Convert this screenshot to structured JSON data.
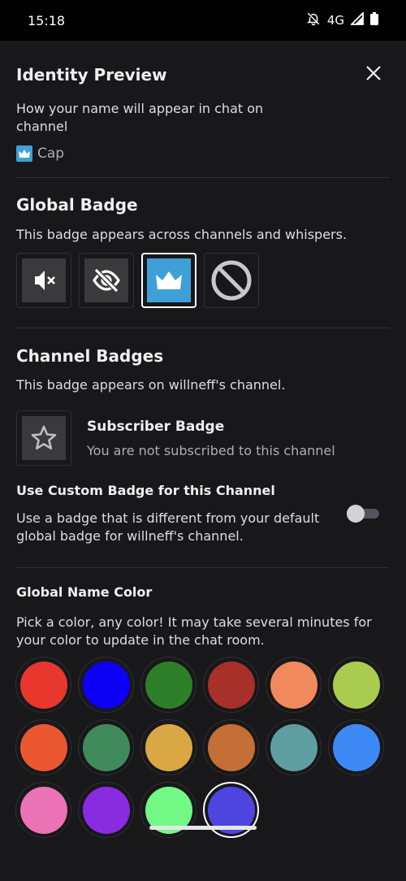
{
  "status_bar": {
    "time": "15:18",
    "network": "4G"
  },
  "header": {
    "title": "Identity Preview"
  },
  "preview": {
    "description": "How your name will appear in chat on channel",
    "name": "Cap"
  },
  "global_badge": {
    "title": "Global Badge",
    "description": "This badge appears across channels and whispers.",
    "badges": [
      {
        "icon": "muted-speaker-icon",
        "selected": false
      },
      {
        "icon": "eye-off-icon",
        "selected": false
      },
      {
        "icon": "crown-icon",
        "selected": true
      },
      {
        "icon": "no-badge-icon",
        "selected": false
      }
    ]
  },
  "channel_badges": {
    "title": "Channel Badges",
    "description": "This badge appears on willneff's channel.",
    "subscriber_title": "Subscriber Badge",
    "subscriber_desc": "You are not subscribed to this channel",
    "custom_title": "Use Custom Badge for this Channel",
    "custom_desc": "Use a badge that is different from your default global badge for willneff's channel.",
    "custom_enabled": false
  },
  "name_color": {
    "title": "Global Name Color",
    "description": "Pick a color, any color! It may take several minutes for your color to update in the chat room.",
    "colors": [
      "#e8372c",
      "#0c00f5",
      "#2d7f2a",
      "#a8302a",
      "#f08a5d",
      "#a9cc4e",
      "#ea5730",
      "#418a5c",
      "#d9a744",
      "#c46f35",
      "#5f9ea0",
      "#3d8af7",
      "#ec72b6",
      "#8a2be2",
      "#72f985",
      "#4e45e0"
    ],
    "selected_index": 15
  }
}
